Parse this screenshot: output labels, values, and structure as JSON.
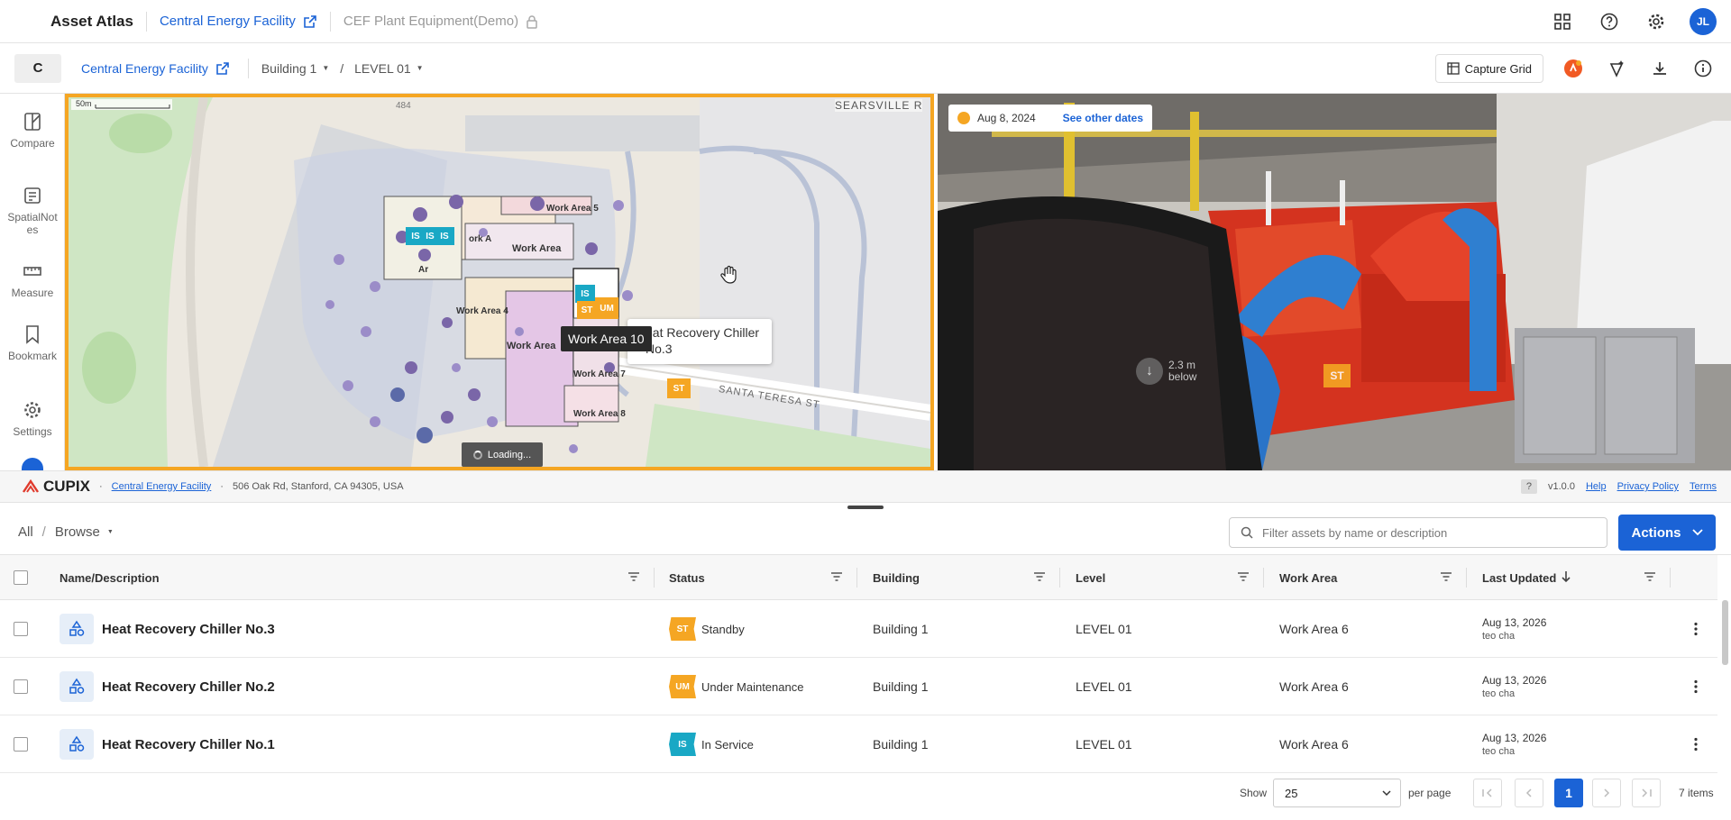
{
  "topbar": {
    "brand": "Asset Atlas",
    "project_link": "Central Energy Facility",
    "locked_project": "CEF Plant Equipment(Demo)",
    "avatar_initials": "JL"
  },
  "subbar": {
    "c_label": "C",
    "facility_link": "Central Energy Facility",
    "building": "Building 1",
    "level": "LEVEL 01",
    "capture_grid": "Capture Grid"
  },
  "leftnav": {
    "compare": "Compare",
    "spatial_notes_1": "SpatialNot",
    "spatial_notes_2": "es",
    "measure": "Measure",
    "bookmark": "Bookmark",
    "settings": "Settings"
  },
  "map": {
    "scale": "50m",
    "road_number": "484",
    "street_top": "SEARSVILLE R",
    "street_bottom": "SANTA TERESA ST",
    "areas": [
      "Work Area 5",
      "Work Area",
      "Work Area 4",
      "Work Area",
      "Work Area 7",
      "Work Area 8",
      "Ar",
      "ork A"
    ],
    "tooltip_dark": "Work Area 10",
    "tooltip_light_1": "eat Recovery Chiller",
    "tooltip_light_2": "No.3",
    "loading": "Loading...",
    "markers": [
      "IS",
      "IS",
      "IS",
      "IS",
      "ST",
      "UM",
      "ST"
    ]
  },
  "pano": {
    "date": "Aug 8, 2024",
    "see_other": "See other dates",
    "below_1": "2.3 m",
    "below_2": "below",
    "marker": "ST"
  },
  "footer": {
    "logo": "CUPIX",
    "facility": "Central Energy Facility",
    "address": "506 Oak Rd, Stanford, CA 94305, USA",
    "q": "?",
    "version": "v1.0.0",
    "help": "Help",
    "privacy": "Privacy Policy",
    "terms": "Terms"
  },
  "browse": {
    "all": "All",
    "slash": "/",
    "browse": "Browse",
    "filter_placeholder": "Filter assets by name or description",
    "actions": "Actions"
  },
  "columns": [
    "Name/Description",
    "Status",
    "Building",
    "Level",
    "Work Area",
    "Last Updated"
  ],
  "status_colors": {
    "ST": "#f5a623",
    "UM": "#f5a623",
    "IS": "#19a8c5"
  },
  "rows": [
    {
      "name": "Heat Recovery Chiller No.3",
      "badge": "ST",
      "status": "Standby",
      "building": "Building 1",
      "level": "LEVEL 01",
      "work_area": "Work Area 6",
      "updated": "Aug 13, 2026",
      "by": "teo cha"
    },
    {
      "name": "Heat Recovery Chiller No.2",
      "badge": "UM",
      "status": "Under Maintenance",
      "building": "Building 1",
      "level": "LEVEL 01",
      "work_area": "Work Area 6",
      "updated": "Aug 13, 2026",
      "by": "teo cha"
    },
    {
      "name": "Heat Recovery Chiller No.1",
      "badge": "IS",
      "status": "In Service",
      "building": "Building 1",
      "level": "LEVEL 01",
      "work_area": "Work Area 6",
      "updated": "Aug 13, 2026",
      "by": "teo cha"
    }
  ],
  "pager": {
    "show": "Show",
    "per_page_value": "25",
    "per_page": "per page",
    "page": "1",
    "total": "7 items"
  }
}
